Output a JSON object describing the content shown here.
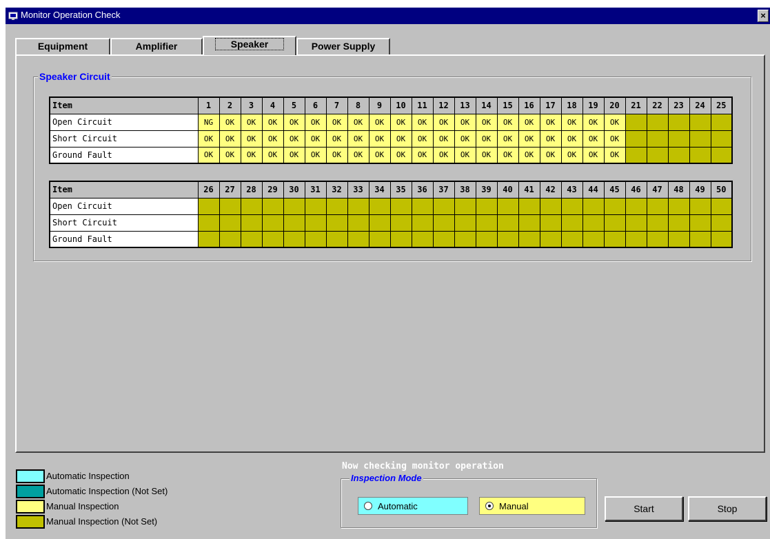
{
  "window": {
    "title": "Monitor Operation Check",
    "close_label": "×"
  },
  "tabs": [
    {
      "label": "Equipment"
    },
    {
      "label": "Amplifier"
    },
    {
      "label": "Speaker",
      "active": true
    },
    {
      "label": "Power Supply"
    }
  ],
  "speaker_group": {
    "title": "Speaker Circuit",
    "tables": [
      {
        "item_header": "Item",
        "columns": [
          "1",
          "2",
          "3",
          "4",
          "5",
          "6",
          "7",
          "8",
          "9",
          "10",
          "11",
          "12",
          "13",
          "14",
          "15",
          "16",
          "17",
          "18",
          "19",
          "20",
          "21",
          "22",
          "23",
          "24",
          "25"
        ],
        "rows": [
          {
            "label": "Open Circuit",
            "results": [
              "NG",
              "OK",
              "OK",
              "OK",
              "OK",
              "OK",
              "OK",
              "OK",
              "OK",
              "OK",
              "OK",
              "OK",
              "OK",
              "OK",
              "OK",
              "OK",
              "OK",
              "OK",
              "OK",
              "OK",
              "",
              "",
              "",
              "",
              ""
            ]
          },
          {
            "label": "Short Circuit",
            "results": [
              "OK",
              "OK",
              "OK",
              "OK",
              "OK",
              "OK",
              "OK",
              "OK",
              "OK",
              "OK",
              "OK",
              "OK",
              "OK",
              "OK",
              "OK",
              "OK",
              "OK",
              "OK",
              "OK",
              "OK",
              "",
              "",
              "",
              "",
              ""
            ]
          },
          {
            "label": "Ground Fault",
            "results": [
              "OK",
              "OK",
              "OK",
              "OK",
              "OK",
              "OK",
              "OK",
              "OK",
              "OK",
              "OK",
              "OK",
              "OK",
              "OK",
              "OK",
              "OK",
              "OK",
              "OK",
              "OK",
              "OK",
              "OK",
              "",
              "",
              "",
              "",
              ""
            ]
          }
        ],
        "configured_count": 20
      },
      {
        "item_header": "Item",
        "columns": [
          "26",
          "27",
          "28",
          "29",
          "30",
          "31",
          "32",
          "33",
          "34",
          "35",
          "36",
          "37",
          "38",
          "39",
          "40",
          "41",
          "42",
          "43",
          "44",
          "45",
          "46",
          "47",
          "48",
          "49",
          "50"
        ],
        "rows": [
          {
            "label": "Open Circuit",
            "results": [
              "",
              "",
              "",
              "",
              "",
              "",
              "",
              "",
              "",
              "",
              "",
              "",
              "",
              "",
              "",
              "",
              "",
              "",
              "",
              "",
              "",
              "",
              "",
              "",
              ""
            ]
          },
          {
            "label": "Short Circuit",
            "results": [
              "",
              "",
              "",
              "",
              "",
              "",
              "",
              "",
              "",
              "",
              "",
              "",
              "",
              "",
              "",
              "",
              "",
              "",
              "",
              "",
              "",
              "",
              "",
              "",
              ""
            ]
          },
          {
            "label": "Ground Fault",
            "results": [
              "",
              "",
              "",
              "",
              "",
              "",
              "",
              "",
              "",
              "",
              "",
              "",
              "",
              "",
              "",
              "",
              "",
              "",
              "",
              "",
              "",
              "",
              "",
              "",
              ""
            ]
          }
        ],
        "configured_count": 0
      }
    ]
  },
  "legend": [
    {
      "label": "Automatic Inspection",
      "color": "#80ffff"
    },
    {
      "label": "Automatic Inspection (Not Set)",
      "color": "#00a0a0"
    },
    {
      "label": "Manual Inspection",
      "color": "#ffff80"
    },
    {
      "label": "Manual Inspection (Not Set)",
      "color": "#c0c000"
    }
  ],
  "status_text": "Now checking monitor operation",
  "inspection_mode": {
    "title": "Inspection Mode",
    "automatic_label": "Automatic",
    "manual_label": "Manual",
    "selected": "Manual",
    "automatic_color": "#80ffff",
    "manual_color": "#ffff80"
  },
  "buttons": {
    "start_label": "Start",
    "stop_label": "Stop"
  },
  "colors": {
    "manual": "#ffff80",
    "manual_not_set": "#c0c000",
    "title_bar": "#000080",
    "group_title": "#0000ff"
  }
}
